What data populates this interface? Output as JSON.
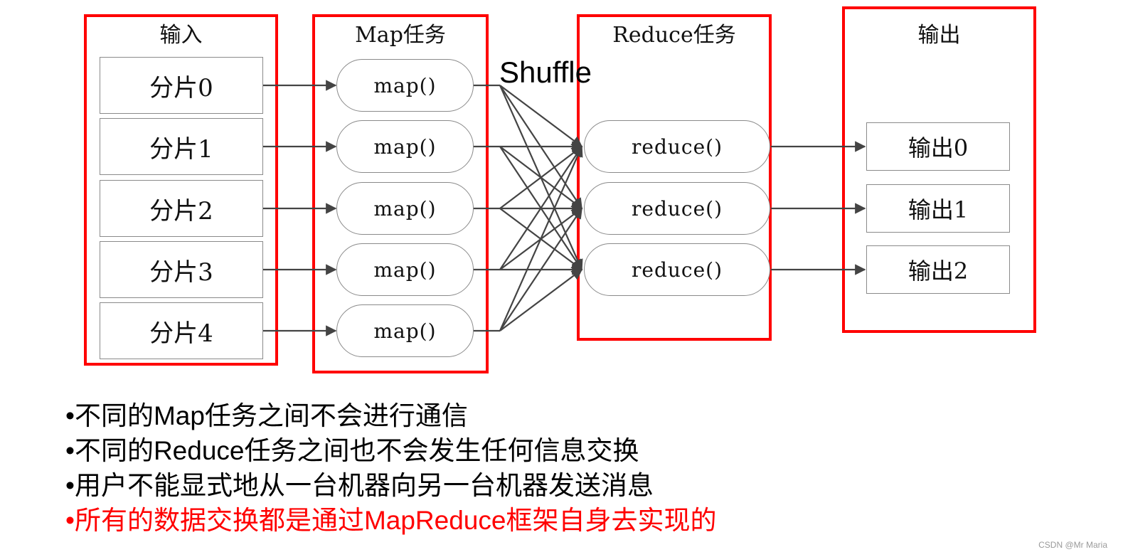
{
  "columns": {
    "input": {
      "title": "输入",
      "splits": [
        "分片0",
        "分片1",
        "分片2",
        "分片3",
        "分片4"
      ]
    },
    "map": {
      "title": "Map任务",
      "tasks": [
        "map()",
        "map()",
        "map()",
        "map()",
        "map()"
      ]
    },
    "reduce": {
      "title": "Reduce任务",
      "tasks": [
        "reduce()",
        "reduce()",
        "reduce()"
      ]
    },
    "output": {
      "title": "输出",
      "outputs": [
        "输出0",
        "输出1",
        "输出2"
      ]
    }
  },
  "shuffle_label": "Shuffle",
  "colors": {
    "frame": "#ff0000",
    "edge": "#444444",
    "highlight_text": "#ff0000",
    "text": "#000000"
  },
  "bullets": [
    {
      "text": "•不同的Map任务之间不会进行通信",
      "color": "#000000"
    },
    {
      "text": "•不同的Reduce任务之间也不会发生任何信息交换",
      "color": "#000000"
    },
    {
      "text": "•用户不能显式地从一台机器向另一台机器发送消息",
      "color": "#000000"
    },
    {
      "text": "•所有的数据交换都是通过MapReduce框架自身去实现的",
      "color": "#ff0000"
    }
  ],
  "watermark": "CSDN @Mr Maria"
}
